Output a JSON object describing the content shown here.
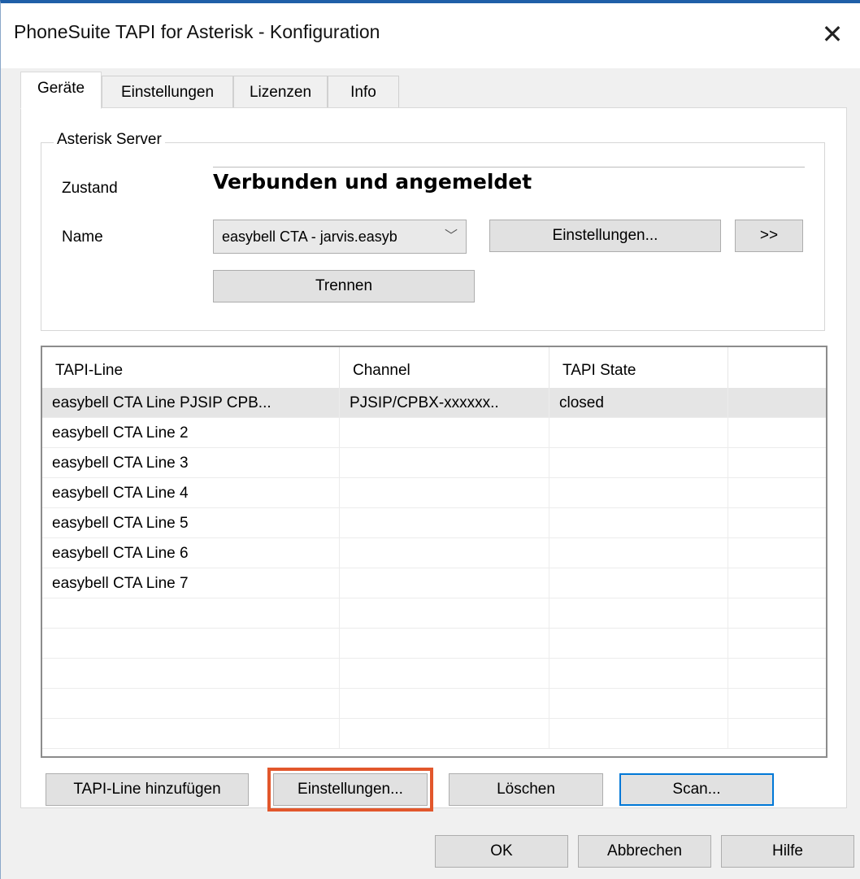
{
  "window": {
    "title": "PhoneSuite TAPI for Asterisk - Konfiguration",
    "close_symbol": "✕"
  },
  "tabs": [
    {
      "label": "Geräte",
      "active": true
    },
    {
      "label": "Einstellungen",
      "active": false
    },
    {
      "label": "Lizenzen",
      "active": false
    },
    {
      "label": "Info",
      "active": false
    }
  ],
  "server_group": {
    "title": "Asterisk Server",
    "state_label": "Zustand",
    "state_value": "Verbunden und angemeldet",
    "name_label": "Name",
    "name_value": "easybell CTA - jarvis.easyb",
    "settings_button": "Einstellungen...",
    "more_button": ">>",
    "disconnect_button": "Trennen"
  },
  "lines_table": {
    "columns": [
      "TAPI-Line",
      "Channel",
      "TAPI State"
    ],
    "rows": [
      {
        "line": "easybell CTA Line  PJSIP CPB...",
        "channel": "PJSIP/CPBX-xxxxxx..",
        "state": "closed",
        "selected": true
      },
      {
        "line": "easybell CTA Line 2",
        "channel": "",
        "state": ""
      },
      {
        "line": "easybell CTA Line 3",
        "channel": "",
        "state": ""
      },
      {
        "line": "easybell CTA Line 4",
        "channel": "",
        "state": ""
      },
      {
        "line": "easybell CTA Line 5",
        "channel": "",
        "state": ""
      },
      {
        "line": "easybell CTA Line 6",
        "channel": "",
        "state": ""
      },
      {
        "line": "easybell CTA Line 7",
        "channel": "",
        "state": ""
      },
      {
        "line": "",
        "channel": "",
        "state": ""
      },
      {
        "line": "",
        "channel": "",
        "state": ""
      },
      {
        "line": "",
        "channel": "",
        "state": ""
      },
      {
        "line": "",
        "channel": "",
        "state": ""
      },
      {
        "line": "",
        "channel": "",
        "state": ""
      }
    ]
  },
  "line_actions": {
    "add": "TAPI-Line hinzufügen",
    "settings": "Einstellungen...",
    "delete": "Löschen",
    "scan": "Scan..."
  },
  "dialog_buttons": {
    "ok": "OK",
    "cancel": "Abbrechen",
    "help": "Hilfe"
  },
  "colors": {
    "highlight_outline": "#e2572c",
    "focus_border": "#0078d7"
  }
}
